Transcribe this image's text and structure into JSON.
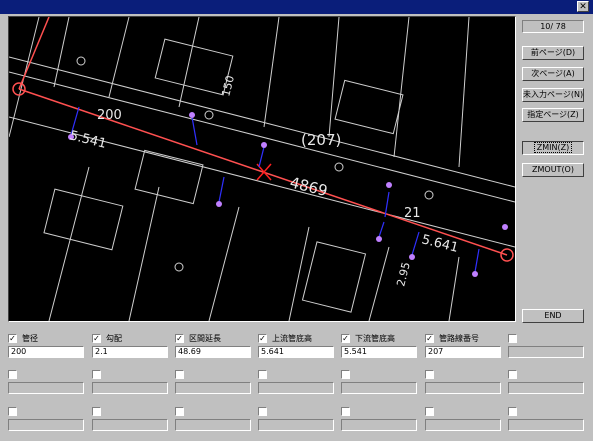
{
  "window": {
    "close_glyph": "✕"
  },
  "map": {
    "labels": {
      "num_a": "200",
      "num_b": "5.541",
      "num_c": "(207)",
      "num_d": "4869",
      "num_e": "5.641",
      "num_f": "150",
      "num_g": "2.95",
      "num_h": "21"
    }
  },
  "sidebar": {
    "page_counter": "10/  78",
    "buttons": [
      {
        "label": "前ページ(D)"
      },
      {
        "label": "次ページ(A)"
      },
      {
        "label": "未入力ページ(N)"
      },
      {
        "label": "指定ページ(Z)"
      },
      {
        "label": "ZMIN(Z)"
      },
      {
        "label": "ZMOUT(O)"
      },
      {
        "label": "END"
      }
    ]
  },
  "fields": [
    {
      "checked": true,
      "label": "管径",
      "value": "200"
    },
    {
      "checked": true,
      "label": "勾配",
      "value": "2.1"
    },
    {
      "checked": true,
      "label": "区間延長",
      "value": "48.69"
    },
    {
      "checked": true,
      "label": "上流管底高",
      "value": "5.641"
    },
    {
      "checked": true,
      "label": "下流管底高",
      "value": "5.541"
    },
    {
      "checked": true,
      "label": "管路線番号",
      "value": "207"
    },
    {
      "checked": false,
      "label": "",
      "value": ""
    }
  ],
  "check_glyph": "✓"
}
